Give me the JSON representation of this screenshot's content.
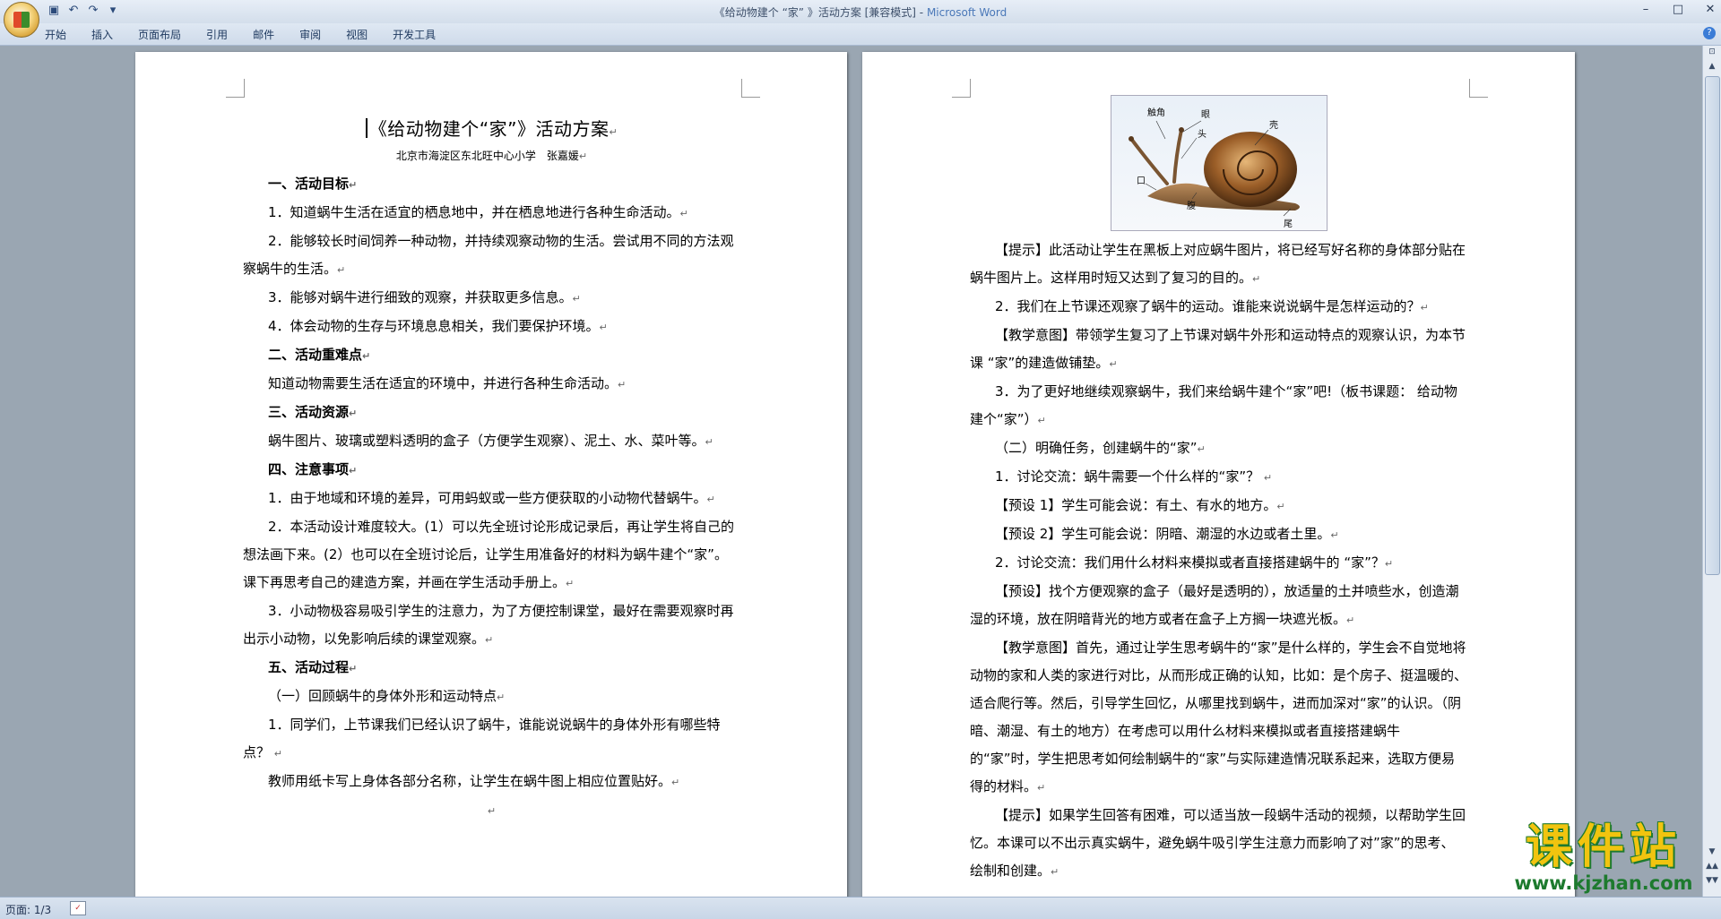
{
  "window": {
    "title_doc": "《给动物建个 “家” 》活动方案 [兼容模式] - ",
    "title_app": "Microsoft Word"
  },
  "ribbon": {
    "tabs": [
      "开始",
      "插入",
      "页面布局",
      "引用",
      "邮件",
      "审阅",
      "视图",
      "开发工具"
    ]
  },
  "left_page": {
    "title": "《给动物建个“家”》活动方案",
    "subtitle": "北京市海淀区东北旺中心小学　张嘉媛",
    "paragraphs": [
      {
        "text": "一、活动目标",
        "style": "h"
      },
      {
        "text": "1．知道蜗牛生活在适宜的栖息地中，并在栖息地进行各种生命活动。",
        "style": "ind"
      },
      {
        "text": "2．能够较长时间饲养一种动物，并持续观察动物的生活。尝试用不同的方法观察蜗牛的生活。",
        "style": "ind"
      },
      {
        "text": "3．能够对蜗牛进行细致的观察，并获取更多信息。",
        "style": "ind"
      },
      {
        "text": "4．体会动物的生存与环境息息相关，我们要保护环境。",
        "style": "ind"
      },
      {
        "text": "二、活动重难点",
        "style": "h"
      },
      {
        "text": " 知道动物需要生活在适宜的环境中，并进行各种生命活动。",
        "style": "ind"
      },
      {
        "text": "三、活动资源",
        "style": "h"
      },
      {
        "text": "蜗牛图片、玻璃或塑料透明的盒子（方便学生观察）、泥土、水、菜叶等。",
        "style": "ind"
      },
      {
        "text": "四、注意事项",
        "style": "h"
      },
      {
        "text": "1．由于地域和环境的差异，可用蚂蚁或一些方便获取的小动物代替蜗牛。",
        "style": "ind"
      },
      {
        "text": "2．本活动设计难度较大。(1）可以先全班讨论形成记录后，再让学生将自己的想法画下来。(2）也可以在全班讨论后，让学生用准备好的材料为蜗牛建个“家”。课下再思考自己的建造方案，并画在学生活动手册上。",
        "style": "ind"
      },
      {
        "text": "3．小动物极容易吸引学生的注意力，为了方便控制课堂，最好在需要观察时再出示小动物，以免影响后续的课堂观察。",
        "style": "ind"
      },
      {
        "text": "五、活动过程",
        "style": "h"
      },
      {
        "text": "（一）回顾蜗牛的身体外形和运动特点",
        "style": "ind"
      },
      {
        "text": "1．同学们，上节课我们已经认识了蜗牛，谁能说说蜗牛的身体外形有哪些特点？ ",
        "style": "ind"
      },
      {
        "text": "教师用纸卡写上身体各部分名称，让学生在蜗牛图上相应位置贴好。",
        "style": "ind"
      }
    ]
  },
  "snail_labels": {
    "chujiao": "触角",
    "yan": "眼",
    "tou": "头",
    "ke": "壳",
    "kou": "口",
    "fu": "腹",
    "wei": "尾"
  },
  "right_page": {
    "paragraphs": [
      "【提示】此活动让学生在黑板上对应蜗牛图片，将已经写好名称的身体部分贴在蜗牛图片上。这样用时短又达到了复习的目的。",
      "2．我们在上节课还观察了蜗牛的运动。谁能来说说蜗牛是怎样运动的？",
      "【教学意图】带领学生复习了上节课对蜗牛外形和运动特点的观察认识，为本节课 “家”的建造做铺垫。",
      "3．为了更好地继续观察蜗牛，我们来给蜗牛建个“家”吧!（板书课题： 给动物建个“家”）",
      "（二）明确任务，创建蜗牛的“家”",
      "1．讨论交流：蜗牛需要一个什么样的“家”？ ",
      "【预设 1】学生可能会说：有土、有水的地方。",
      "【预设 2】学生可能会说：阴暗、潮湿的水边或者土里。",
      "2．讨论交流：我们用什么材料来模拟或者直接搭建蜗牛的 “家”？",
      "【预设】找个方便观察的盒子（最好是透明的），放适量的土并喷些水，创造潮湿的环境，放在阴暗背光的地方或者在盒子上方搁一块遮光板。",
      "【教学意图】首先，通过让学生思考蜗牛的“家”是什么样的，学生会不自觉地将动物的家和人类的家进行对比，从而形成正确的认知，比如：是个房子、挺温暖的、适合爬行等。然后，引导学生回忆，从哪里找到蜗牛，进而加深对“家”的认识。（阴暗、潮湿、有土的地方）在考虑可以用什么材料来模拟或者直接搭建蜗牛的“家”时，学生把思考如何绘制蜗牛的“家”与实际建造情况联系起来，选取方便易得的材料。",
      "【提示】如果学生回答有困难，可以适当放一段蜗牛活动的视频，以帮助学生回忆。本课可以不出示真实蜗牛，避免蜗牛吸引学生注意力而影响了对”家”的思考、绘制和创建。"
    ]
  },
  "status": {
    "page_info": "页面: 1/3"
  },
  "watermark": {
    "title": "课件站",
    "url": "www.kjzhan.com"
  },
  "colors": {
    "accent": "#4a78b8",
    "watermark_yellow": "#f1c40f",
    "watermark_green": "#1d7a2e"
  }
}
